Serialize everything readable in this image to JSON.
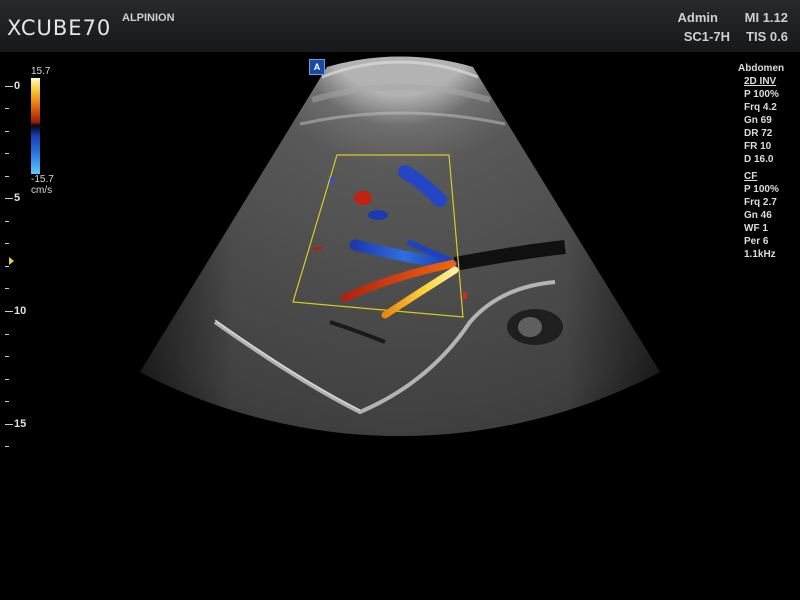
{
  "header": {
    "brand": "XCUBE70",
    "maker": "ALPINION",
    "user": "Admin",
    "mi": "MI 1.12",
    "probe": "SC1-7H",
    "tis": "TIS 0.6"
  },
  "depth_scale": {
    "labels": [
      "0",
      "5",
      "10",
      "15"
    ],
    "unit_marker": "focus"
  },
  "color_bar": {
    "max": "15.7",
    "min": "-15.7",
    "unit": "cm/s"
  },
  "panel": {
    "preset": "Abdomen",
    "mode_2d": {
      "title": "2D INV",
      "items": [
        "P 100%",
        "Frq 4.2",
        "Gn 69",
        "DR 72",
        "FR 10",
        "D 16.0"
      ]
    },
    "mode_cf": {
      "title": "CF",
      "items": [
        "P 100%",
        "Frq 2.7",
        "Gn 46",
        "WF 1",
        "Per 6",
        "1.1kHz"
      ]
    }
  },
  "icons": {
    "logo_mark": "A"
  }
}
